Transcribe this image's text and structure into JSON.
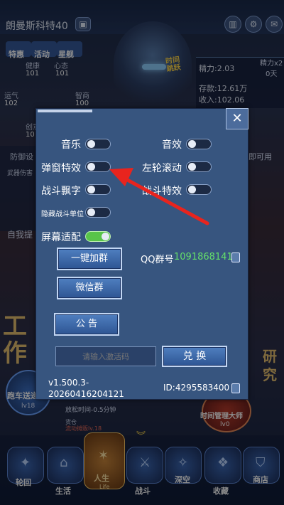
{
  "header": {
    "player_name": "朗曼斯科特40",
    "bag_icon": "briefcase-icon",
    "icons": [
      "stats-icon",
      "gear-icon",
      "mail-icon"
    ]
  },
  "badges": [
    {
      "label": "特惠"
    },
    {
      "label": "活动"
    },
    {
      "label": "星舰"
    }
  ],
  "stats": {
    "health_label": "健康",
    "health_value": "101",
    "mind_label": "心态",
    "mind_value": "101",
    "luck_label": "运气",
    "luck_value": "102",
    "smart_label": "智商",
    "smart_value": "100",
    "create_label": "创意",
    "create_value": "10"
  },
  "right_stats": {
    "energy": "精力:2.03",
    "savings": "存款:12.61万",
    "income": "收入:102.06"
  },
  "video": {
    "label": "精力x2",
    "sub": "0天"
  },
  "time_jump": "时间\n跳跃",
  "background": {
    "defense": "防御设",
    "weapon": "武器伤害",
    "self_text": "自我提",
    "quick_text": "即可用",
    "work_chars": "工\n作",
    "research_chars": "研\n究",
    "car_label": "跑车送递",
    "car_level": "lv18",
    "relax": "放松时间-0.5分钟",
    "cafe": "流动摊贩lv.18",
    "time_master": "时间管理大师",
    "time_master_level": "lv0",
    "bag_left": "货仓"
  },
  "settings": {
    "close_label": "✕",
    "options": [
      {
        "label": "音乐",
        "on": false
      },
      {
        "label": "音效",
        "on": false
      },
      {
        "label": "弹窗特效",
        "on": false
      },
      {
        "label": "左轮滚动",
        "on": false
      },
      {
        "label": "战斗飘字",
        "on": false
      },
      {
        "label": "战斗特效",
        "on": false
      },
      {
        "label": "隐藏战斗单位",
        "on": false
      },
      {
        "label": "屏幕适配",
        "on": true
      }
    ],
    "join_group": "一键加群",
    "wechat_group": "微信群",
    "announcement": "公 告",
    "qq_label": "QQ群号",
    "qq_number": "1091868141",
    "code_placeholder": "请输入激活码",
    "redeem": "兑 换",
    "version_line1": "v1.500.3-",
    "version_line2": "20260416204121",
    "user_id": "ID:4295583400"
  },
  "nav": [
    {
      "label": "轮回",
      "icon": "cycle-icon"
    },
    {
      "label": "生活",
      "icon": "life-icon"
    },
    {
      "label": "人生",
      "icon": "star-icon",
      "active": true,
      "sub": "Life"
    },
    {
      "label": "战斗",
      "icon": "battle-icon"
    },
    {
      "label": "深空",
      "icon": "space-icon"
    },
    {
      "label": "收藏",
      "icon": "collection-icon"
    },
    {
      "label": "商店",
      "icon": "shop-icon"
    }
  ],
  "colors": {
    "accent_green": "#58c44a",
    "qq_green": "#65e06a",
    "dialog_bg": "#37557f",
    "arrow_red": "#e8241e"
  }
}
